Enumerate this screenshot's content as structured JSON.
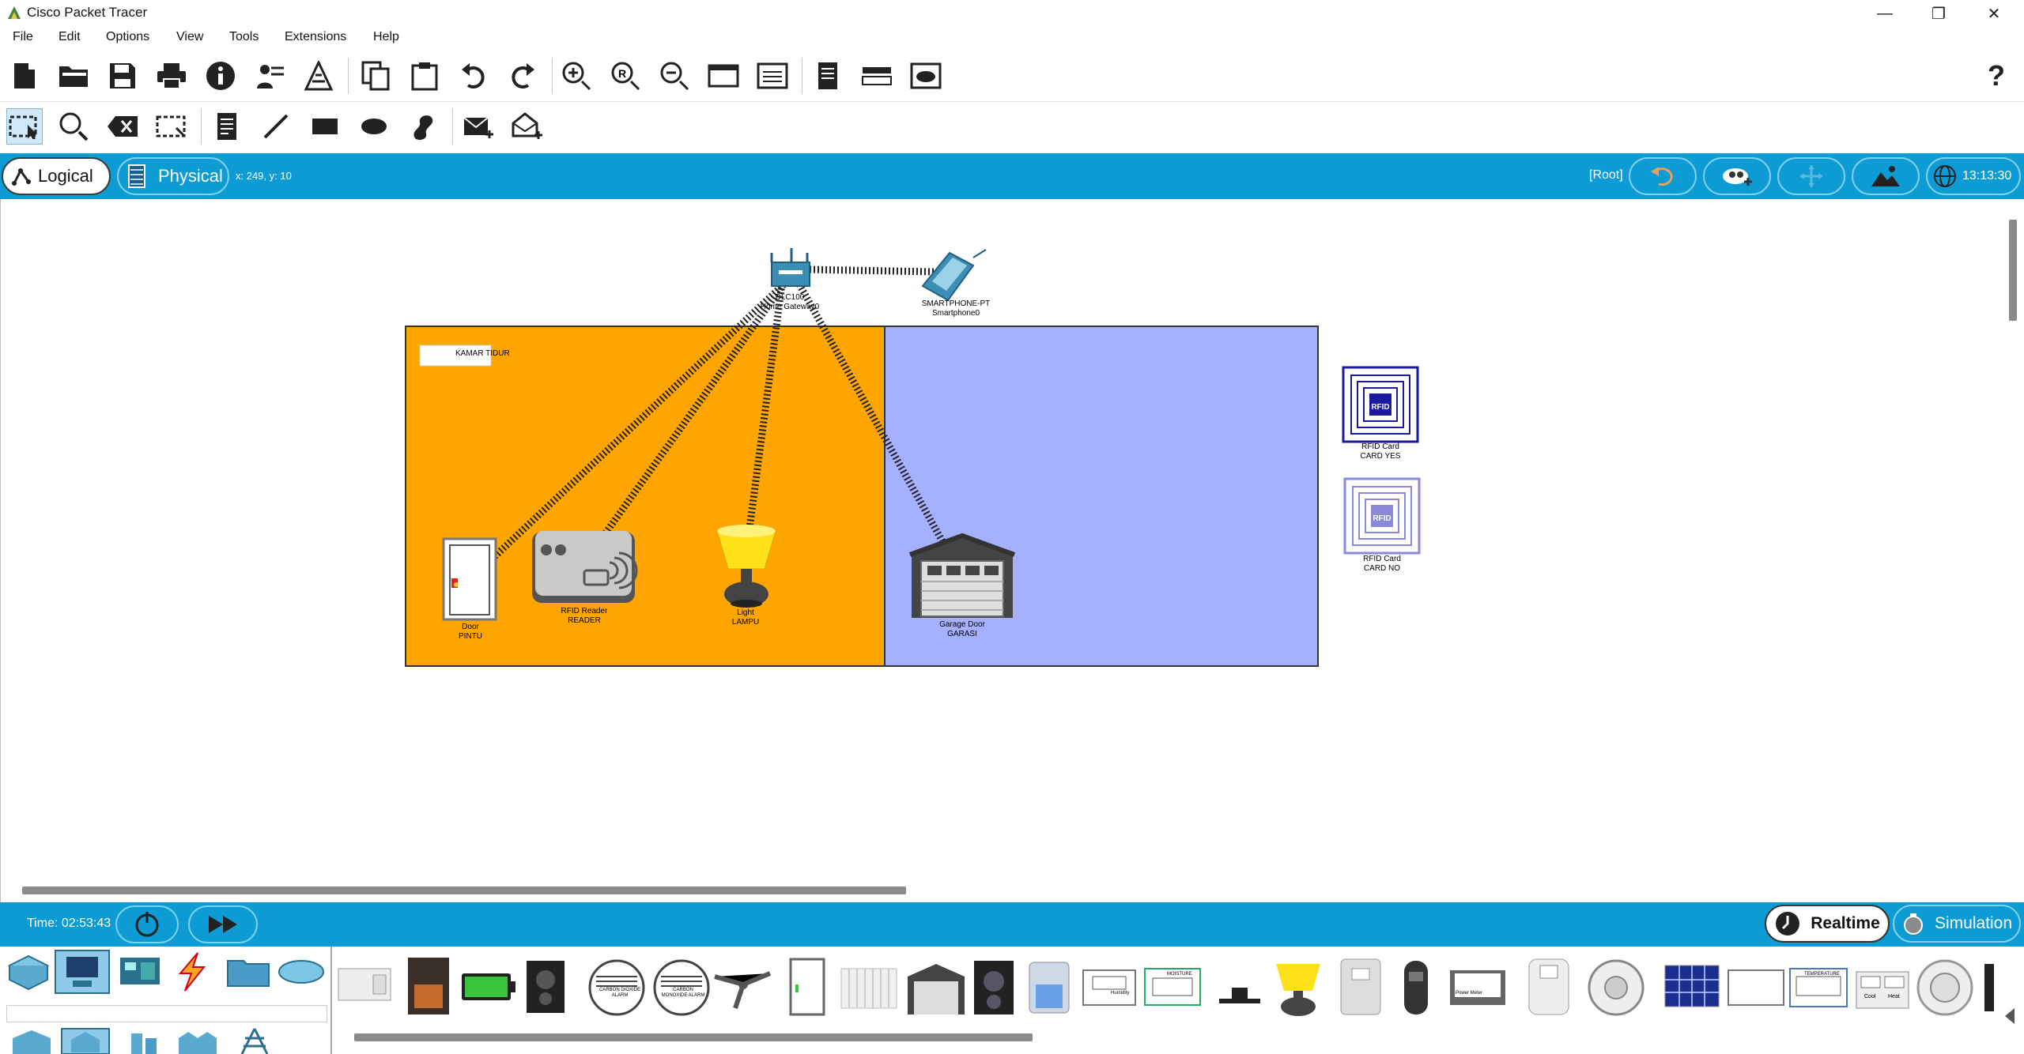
{
  "window": {
    "title": "Cisco Packet Tracer",
    "controls": [
      "—",
      "❐",
      "✕"
    ]
  },
  "menu": [
    "File",
    "Edit",
    "Options",
    "View",
    "Tools",
    "Extensions",
    "Help"
  ],
  "help_glyph": "?",
  "viewbar": {
    "logical_label": "Logical",
    "physical_label": "Physical",
    "coords": "x: 249, y: 10",
    "root_label": "[Root]",
    "clock": "13:13:30"
  },
  "workspace": {
    "rooms": [
      {
        "label": "KAMAR TIDUR",
        "color": "#FFA500"
      },
      {
        "label": "",
        "color": "#A5B0FF"
      }
    ],
    "devices": {
      "gateway": {
        "line1": "DLC100",
        "line2": "Home Gateway0"
      },
      "smartphone": {
        "line1": "SMARTPHONE-PT",
        "line2": "Smartphone0"
      },
      "door": {
        "line1": "Door",
        "line2": "PINTU"
      },
      "rfid_reader": {
        "line1": "RFID Reader",
        "line2": "READER"
      },
      "light": {
        "line1": "Light",
        "line2": "LAMPU"
      },
      "garage": {
        "line1": "Garage Door",
        "line2": "GARASI"
      },
      "card_yes": {
        "line1": "RFID Card",
        "line2": "CARD YES",
        "tag": "RFID"
      },
      "card_no": {
        "line1": "RFID Card",
        "line2": "CARD NO",
        "tag": "RFID"
      }
    }
  },
  "timebar": {
    "time": "Time: 02:53:43",
    "realtime_label": "Realtime",
    "simulation_label": "Simulation"
  },
  "palette_labels": {
    "carbon_dioxide": "CARBON DIOXIDE ALARM",
    "carbon_monoxide": "CARBON MONOXIDE ALARM",
    "humidity": "Humidity",
    "moisture": "MOISTURE",
    "power_meter": "Power Meter",
    "temperature": "TEMPERATURE",
    "cool": "Cool",
    "heat": "Heat"
  },
  "colors": {
    "accent": "#0C9BD3",
    "room1": "#FFA500",
    "room2": "#A5B0FF"
  }
}
